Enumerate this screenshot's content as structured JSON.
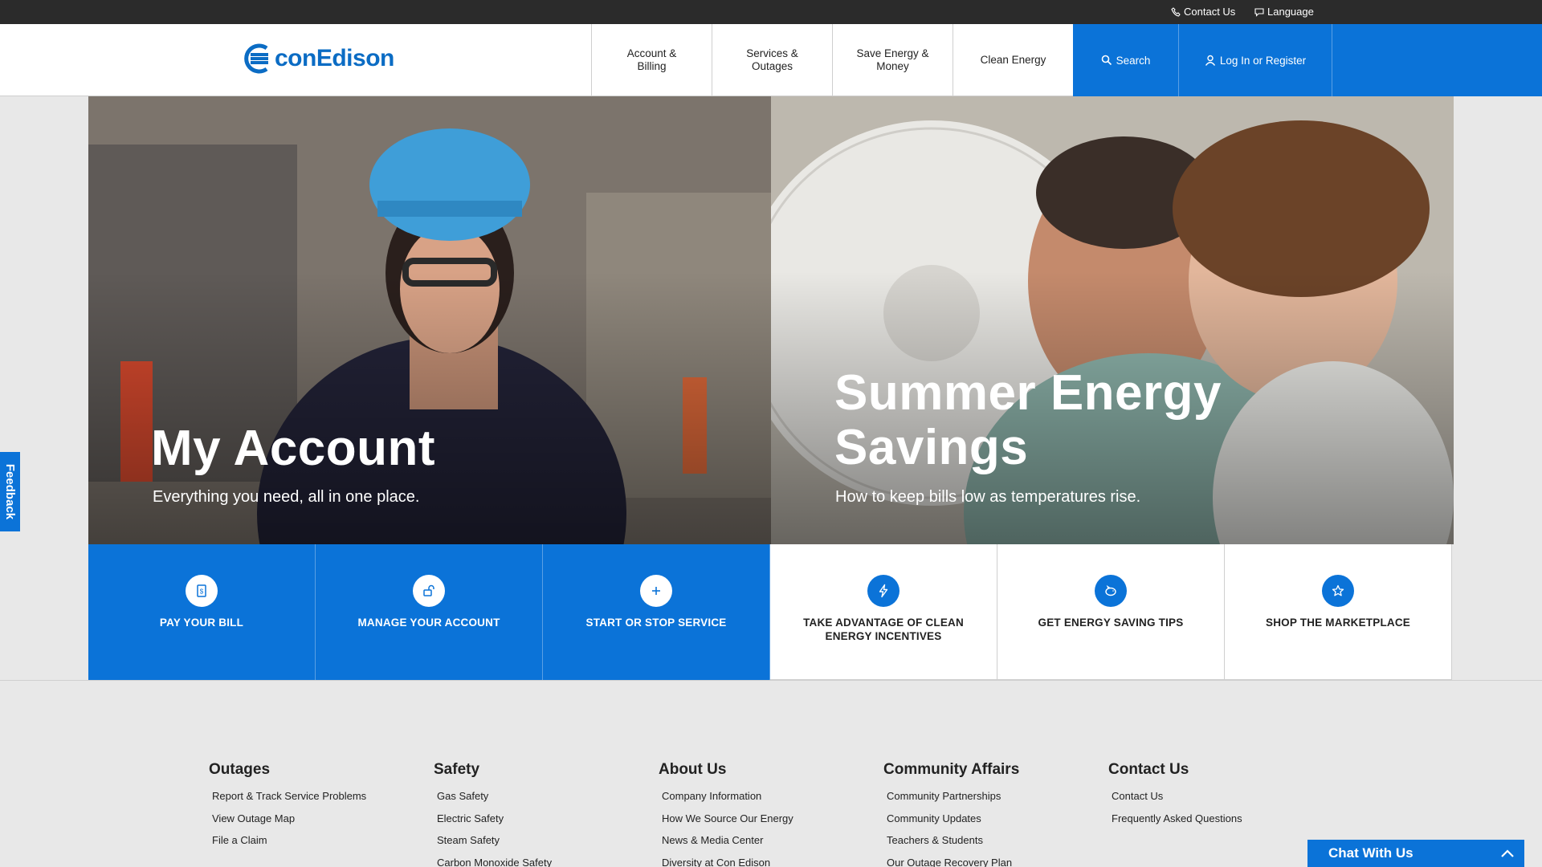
{
  "utility": {
    "contact_label": "Contact Us",
    "language_label": "Language"
  },
  "brand": {
    "logo_text": "conEdison",
    "accent_color": "#0b73d8"
  },
  "nav": {
    "items": [
      {
        "line1": "Account &",
        "line2": "Billing"
      },
      {
        "line1": "Services &",
        "line2": "Outages"
      },
      {
        "line1": "Save Energy &",
        "line2": "Money"
      },
      {
        "line1": "Clean Energy",
        "line2": ""
      }
    ],
    "search_label": "Search",
    "login_label": "Log In or Register"
  },
  "hero": {
    "left": {
      "title": "My Account",
      "subtitle": "Everything you need, all in one place."
    },
    "right": {
      "title_line1": "Summer Energy",
      "title_line2": "Savings",
      "subtitle": "How to keep bills low as temperatures rise."
    }
  },
  "quick_links": [
    {
      "label": "PAY YOUR BILL",
      "icon": "bill-icon"
    },
    {
      "label": "MANAGE YOUR ACCOUNT",
      "icon": "lock-icon"
    },
    {
      "label": "START OR STOP SERVICE",
      "icon": "plus-icon"
    },
    {
      "label": "TAKE ADVANTAGE OF CLEAN ENERGY INCENTIVES",
      "icon": "lightning-icon"
    },
    {
      "label": "GET ENERGY SAVING TIPS",
      "icon": "piggy-bank-icon"
    },
    {
      "label": "SHOP THE MARKETPLACE",
      "icon": "star-icon"
    }
  ],
  "footer": {
    "columns": [
      {
        "heading": "Outages",
        "links": [
          "Report & Track Service Problems",
          "View Outage Map",
          "File a Claim"
        ]
      },
      {
        "heading": "Safety",
        "links": [
          "Gas Safety",
          "Electric Safety",
          "Steam Safety",
          "Carbon Monoxide Safety"
        ]
      },
      {
        "heading": "About Us",
        "links": [
          "Company Information",
          "How We Source Our Energy",
          "News & Media Center",
          "Diversity at Con Edison"
        ]
      },
      {
        "heading": "Community Affairs",
        "links": [
          "Community Partnerships",
          "Community Updates",
          "Teachers & Students",
          "Our Outage Recovery Plan"
        ]
      },
      {
        "heading": "Contact Us",
        "links": [
          "Contact Us",
          "Frequently Asked Questions"
        ]
      }
    ]
  },
  "feedback_label": "Feedback",
  "chat_label": "Chat With Us"
}
